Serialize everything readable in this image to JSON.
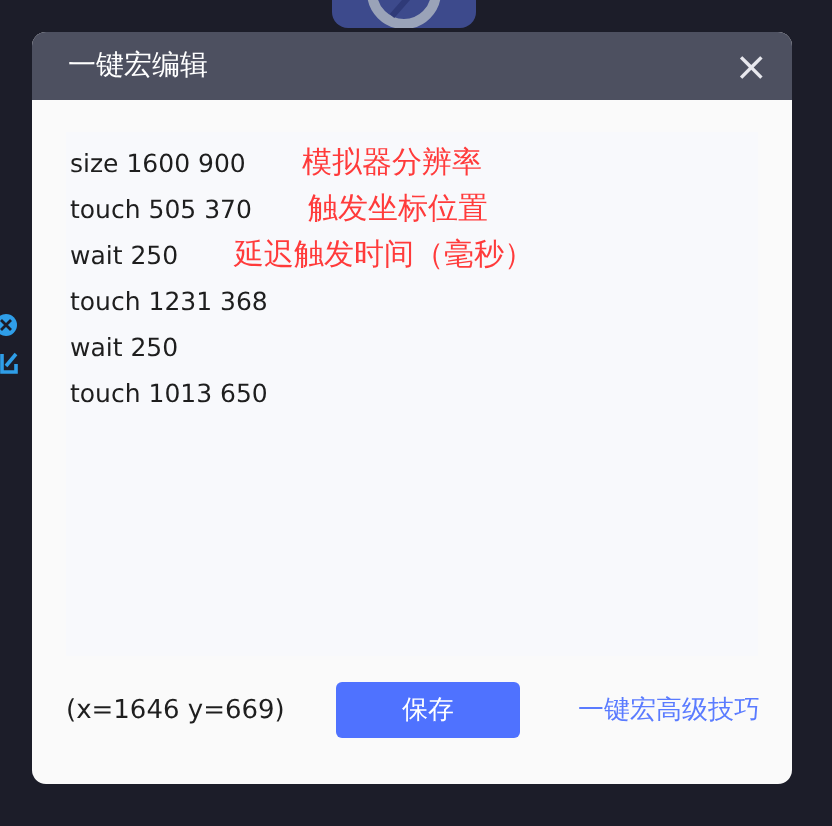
{
  "window": {
    "title": "一键宏编辑",
    "close": "×"
  },
  "script_lines": [
    {
      "command": "size 1600 900",
      "note": "模拟器分辨率"
    },
    {
      "command": "touch 505 370",
      "note": "触发坐标位置"
    },
    {
      "command": "wait 250",
      "note": "延迟触发时间（毫秒）"
    },
    {
      "command": "touch 1231 368"
    },
    {
      "command": "wait 250"
    },
    {
      "command": "touch 1013 650"
    }
  ],
  "footer": {
    "coordinates": "(x=1646  y=669)",
    "save_button": "保存",
    "help_link": "一键宏高级技巧"
  }
}
